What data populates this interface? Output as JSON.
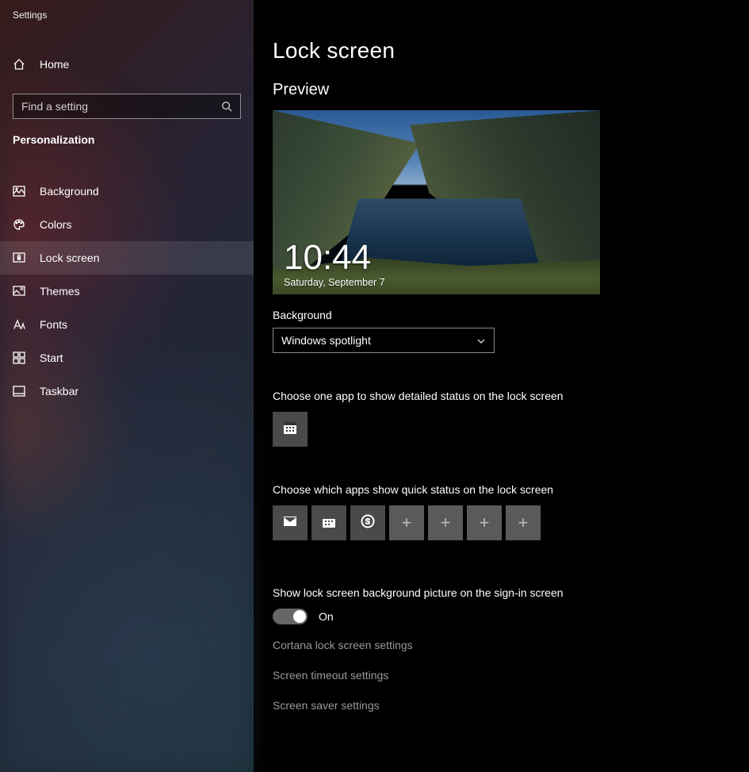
{
  "app_title": "Settings",
  "home_label": "Home",
  "search_placeholder": "Find a setting",
  "category": "Personalization",
  "sidebar": {
    "items": [
      {
        "label": "Background"
      },
      {
        "label": "Colors"
      },
      {
        "label": "Lock screen"
      },
      {
        "label": "Themes"
      },
      {
        "label": "Fonts"
      },
      {
        "label": "Start"
      },
      {
        "label": "Taskbar"
      }
    ]
  },
  "page": {
    "title": "Lock screen",
    "preview_heading": "Preview",
    "clock": "10:44",
    "date": "Saturday, September 7",
    "background_label": "Background",
    "background_value": "Windows spotlight",
    "detailed_label": "Choose one app to show detailed status on the lock screen",
    "quick_label": "Choose which apps show quick status on the lock screen",
    "signin_bg_label": "Show lock screen background picture on the sign-in screen",
    "toggle_state": "On",
    "links": [
      "Cortana lock screen settings",
      "Screen timeout settings",
      "Screen saver settings"
    ]
  }
}
